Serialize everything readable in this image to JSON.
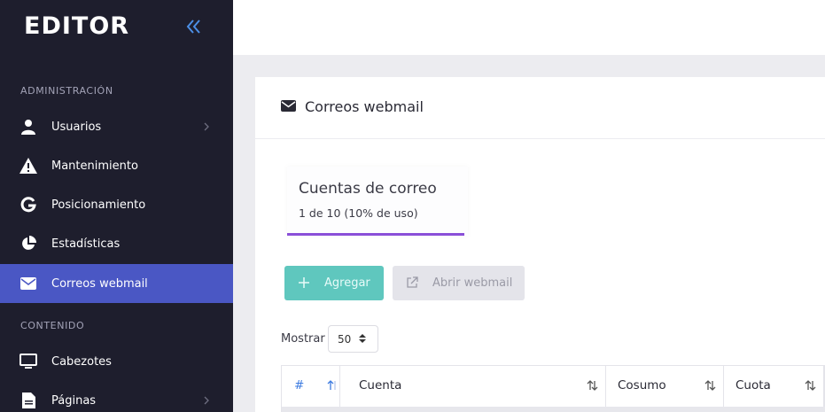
{
  "app": {
    "logo": "EDITOR"
  },
  "sidebar": {
    "sections": [
      {
        "title": "ADMINISTRACIÓN"
      },
      {
        "title": "CONTENIDO"
      }
    ],
    "items": [
      {
        "label": "Usuarios",
        "icon": "user-icon",
        "has_chevron": true
      },
      {
        "label": "Mantenimiento",
        "icon": "warning-icon",
        "has_chevron": false
      },
      {
        "label": "Posicionamiento",
        "icon": "google-icon",
        "has_chevron": false
      },
      {
        "label": "Estadísticas",
        "icon": "pie-chart-icon",
        "has_chevron": false
      },
      {
        "label": "Correos webmail",
        "icon": "envelope-icon",
        "active": true,
        "has_chevron": false
      },
      {
        "label": "Cabezotes",
        "icon": "monitor-icon",
        "has_chevron": false
      },
      {
        "label": "Páginas",
        "icon": "file-icon",
        "has_chevron": true
      }
    ]
  },
  "page": {
    "title": "Correos webmail",
    "stat": {
      "title": "Cuentas de correo",
      "subtitle": "1 de 10 (10% de uso)",
      "usage_fraction": 0.1,
      "accent": "#8a4fd8"
    },
    "buttons": {
      "add": "Agregar",
      "webmail": "Abrir webmail"
    },
    "show": {
      "label": "Mostrar",
      "value": "50"
    },
    "table": {
      "columns": [
        {
          "label": "#"
        },
        {
          "label": "Cuenta"
        },
        {
          "label": "Cosumo"
        },
        {
          "label": "Cuota"
        }
      ]
    }
  },
  "colors": {
    "sidebar_bg": "#1e1e2d",
    "active_item": "#4a57c4",
    "add_button": "#5fc7be",
    "accent_blue": "#3d7be0"
  }
}
